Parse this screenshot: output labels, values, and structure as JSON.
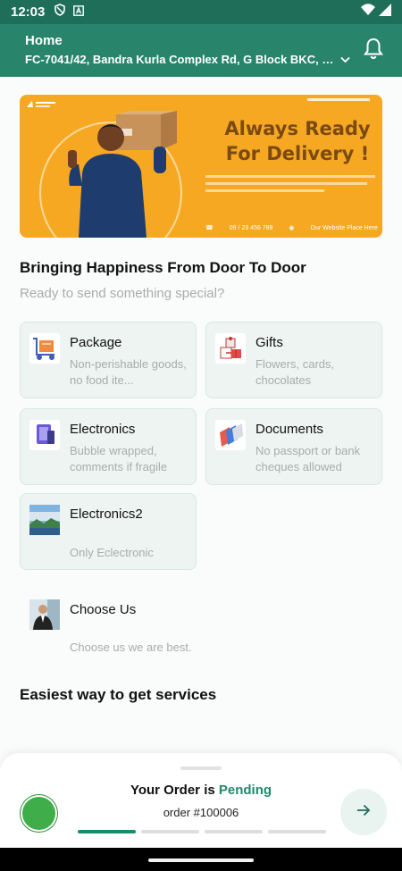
{
  "status_bar": {
    "time": "12:03"
  },
  "header": {
    "title": "Home",
    "address": "FC-7041/42, Bandra Kurla Complex Rd, G Block BKC, Band..."
  },
  "banner": {
    "headline_line1": "Always Ready",
    "headline_line2": "For Delivery !",
    "phone": "09 / 23 456 789",
    "website": "Our Website Place Here",
    "colors": {
      "background": "#f7a823",
      "headline": "#7a4a12"
    }
  },
  "intro": {
    "title": "Bringing Happiness From Door To Door",
    "subtitle": "Ready to send something special?"
  },
  "categories": [
    {
      "name": "Package",
      "desc": "Non-perishable goods, no food ite...",
      "icon": "package-icon"
    },
    {
      "name": "Gifts",
      "desc": "Flowers, cards, chocolates",
      "icon": "gift-icon"
    },
    {
      "name": "Electronics",
      "desc": "Bubble wrapped, comments if fragile",
      "icon": "electronics-icon"
    },
    {
      "name": "Documents",
      "desc": "No passport or bank cheques allowed",
      "icon": "documents-icon"
    },
    {
      "name": "Electronics2",
      "desc": "Only Eclectronic",
      "icon": "landscape-thumbnail-icon"
    }
  ],
  "choose_us": {
    "name": "Choose Us",
    "desc": "Choose us we are best.",
    "icon": "businessman-icon"
  },
  "services": {
    "title": "Easiest way to get services"
  },
  "order_sheet": {
    "status_prefix": "Your Order is",
    "status": "Pending",
    "order_id": "order #100006",
    "progress_steps": 4,
    "progress_done": 1,
    "colors": {
      "accent": "#1e8a6c",
      "dot": "#3fae4a"
    }
  },
  "theme": {
    "primary": "#28856c",
    "status_bar": "#1e6e5a"
  }
}
